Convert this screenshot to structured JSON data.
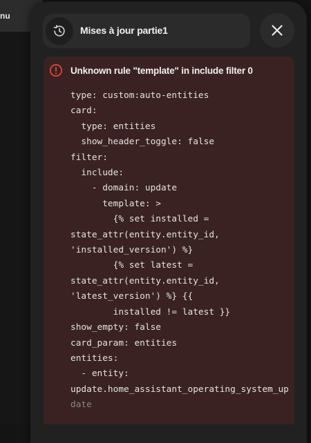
{
  "background": {
    "chip_label": "nu"
  },
  "dialog": {
    "title": "Mises à jour partie1",
    "history_icon": "history-icon",
    "close_icon": "close-icon"
  },
  "error": {
    "icon": "alert-circle-icon",
    "title": "Unknown rule \"template\" in include filter 0",
    "yaml_lines": [
      "type: custom:auto-entities",
      "card:",
      "  type: entities",
      "  show_header_toggle: false",
      "filter:",
      "  include:",
      "    - domain: update",
      "      template: >",
      "        {% set installed =",
      "state_attr(entity.entity_id,",
      "'installed_version') %}",
      "        {% set latest =",
      "state_attr(entity.entity_id,",
      "'latest_version') %} {{",
      "        installed != latest }}",
      "show_empty: false",
      "card_param: entities",
      "entities:",
      "  - entity:",
      "update.home_assistant_operating_system_up",
      "date"
    ]
  },
  "colors": {
    "error_accent": "#e0453a",
    "error_background": "#3a2222",
    "dialog_background": "#212121"
  }
}
